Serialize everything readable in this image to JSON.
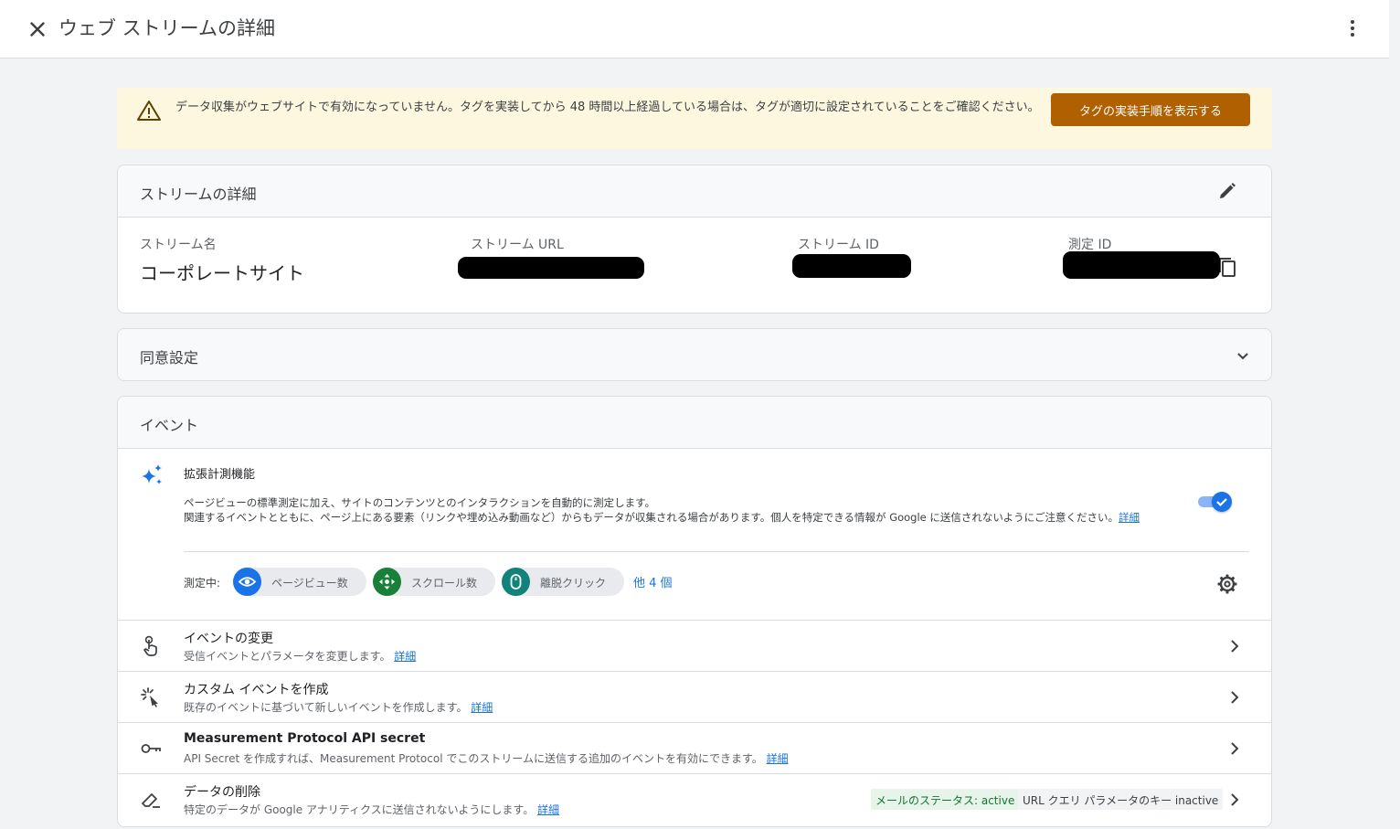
{
  "header": {
    "title": "ウェブ ストリームの詳細"
  },
  "banner": {
    "message": "データ収集がウェブサイトで有効になっていません。タグを実装してから 48 時間以上経過している場合は、タグが適切に設定されていることをご確認ください。",
    "button_label": "タグの実装手順を表示する"
  },
  "stream_details": {
    "heading": "ストリームの詳細",
    "stream_name_label": "ストリーム名",
    "stream_name_value": "コーポレートサイト",
    "stream_url_label": "ストリーム URL",
    "stream_id_label": "ストリーム ID",
    "measurement_id_label": "測定 ID"
  },
  "consent": {
    "heading": "同意設定"
  },
  "events": {
    "heading": "イベント",
    "enhanced": {
      "title": "拡張計測機能",
      "desc_line1": "ページビューの標準測定に加え、サイトのコンテンツとのインタラクションを自動的に測定します。",
      "desc_line2": "関連するイベントとともに、ページ上にある要素（リンクや埋め込み動画など）からもデータが収集される場合があります。個人を特定できる情報が Google に送信されないようにご注意ください。",
      "desc_link": "詳細",
      "enabled": true,
      "measuring_label": "測定中:",
      "chips": [
        {
          "label": "ページビュー数",
          "icon": "eye-icon",
          "color": "#1a73e8"
        },
        {
          "label": "スクロール数",
          "icon": "scroll-icon",
          "color": "#188038"
        },
        {
          "label": "離脱クリック",
          "icon": "mouse-icon",
          "color": "#12837a"
        }
      ],
      "more_label": "他 4 個"
    },
    "rows": [
      {
        "title": "イベントの変更",
        "subtitle": "受信イベントとパラメータを変更します。",
        "link": "詳細"
      },
      {
        "title": "カスタム イベントを作成",
        "subtitle": "既存のイベントに基づいて新しいイベントを作成します。",
        "link": "詳細"
      },
      {
        "title": "Measurement Protocol API secret",
        "subtitle": "API Secret を作成すれば、Measurement Protocol でこのストリームに送信する追加のイベントを有効にできます。",
        "link": "詳細"
      },
      {
        "title": "データの削除",
        "subtitle": "特定のデータが Google アナリティクスに送信されないようにします。",
        "link": "詳細",
        "badge_active": "メールのステータス: active",
        "badge_inactive": "URL クエリ パラメータのキー inactive"
      }
    ]
  },
  "colors": {
    "accent": "#1a73e8",
    "warning_bg": "#fef7e0",
    "warning_button": "#b06000",
    "active_badge_bg": "#e6f4ea",
    "active_badge_text": "#137333",
    "inactive_badge_bg": "#f1f3f4"
  }
}
